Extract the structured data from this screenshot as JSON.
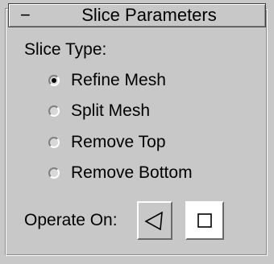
{
  "rollout": {
    "collapse_glyph": "−",
    "title": "Slice Parameters"
  },
  "slice_type": {
    "label": "Slice Type:",
    "options": [
      {
        "label": "Refine Mesh",
        "checked": true
      },
      {
        "label": "Split Mesh",
        "checked": false
      },
      {
        "label": "Remove Top",
        "checked": false
      },
      {
        "label": "Remove Bottom",
        "checked": false
      }
    ]
  },
  "operate_on": {
    "label": "Operate On:",
    "buttons": [
      {
        "icon": "face-triangle-icon",
        "active": false
      },
      {
        "icon": "polygon-square-icon",
        "active": true
      }
    ]
  }
}
